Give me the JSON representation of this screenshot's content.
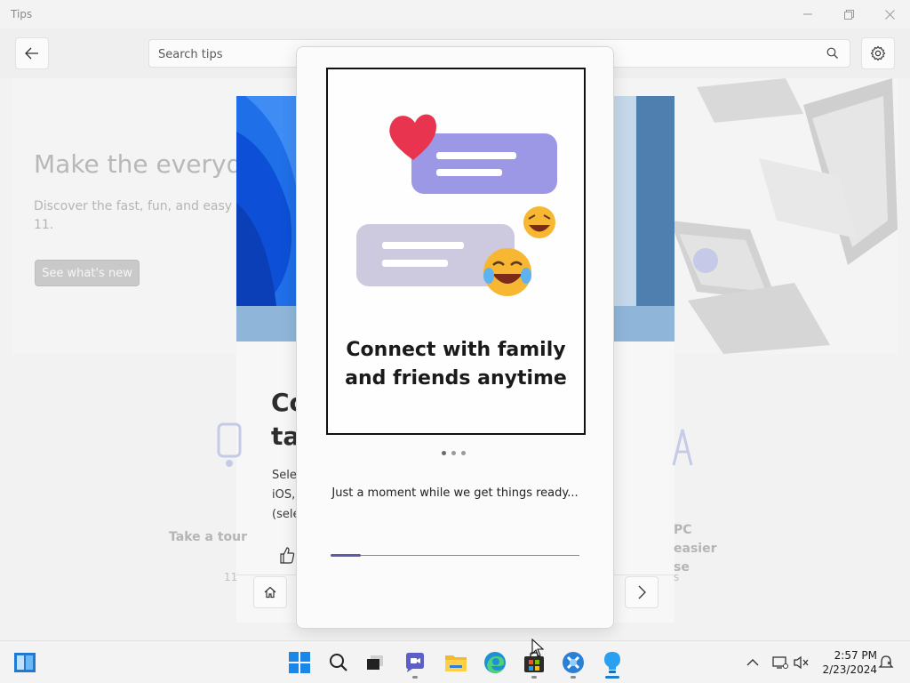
{
  "app": {
    "title": "Tips"
  },
  "window": {
    "minimize_glyph": "—",
    "maximize_glyph": "❐",
    "close_glyph": "✕"
  },
  "search": {
    "placeholder": "Search tips",
    "value": ""
  },
  "hero": {
    "headline": "Make the everyd",
    "body": "Discover the fast, fun, and easy 11.",
    "button_label": "See what's new"
  },
  "card": {
    "heading": "Co ta",
    "body": "Sele iOS, (sele",
    "body_right": "a"
  },
  "side_items": {
    "left_label": "Take a tour",
    "left_sub": "11",
    "right_label": "PC easier se",
    "right_sub": "s"
  },
  "modal": {
    "headline": "Connect with family and friends anytime",
    "status": "Just a moment while we get things ready...",
    "progress": 0.12,
    "dots_count": 3,
    "active_dot": 0
  },
  "tray": {
    "time": "2:57 PM",
    "date": "2/23/2024"
  },
  "icons": {
    "back": "back-arrow-icon",
    "search": "search-icon",
    "settings": "gear-icon",
    "home": "home-icon",
    "next": "chevron-right-icon",
    "thumb": "thumbs-up-icon"
  },
  "colors": {
    "accent": "#5e5ba8",
    "bubble_purple": "#9c98e6",
    "bubble_grey": "#c9c6dc",
    "heart": "#e8344e",
    "emoji": "#f7b733"
  }
}
